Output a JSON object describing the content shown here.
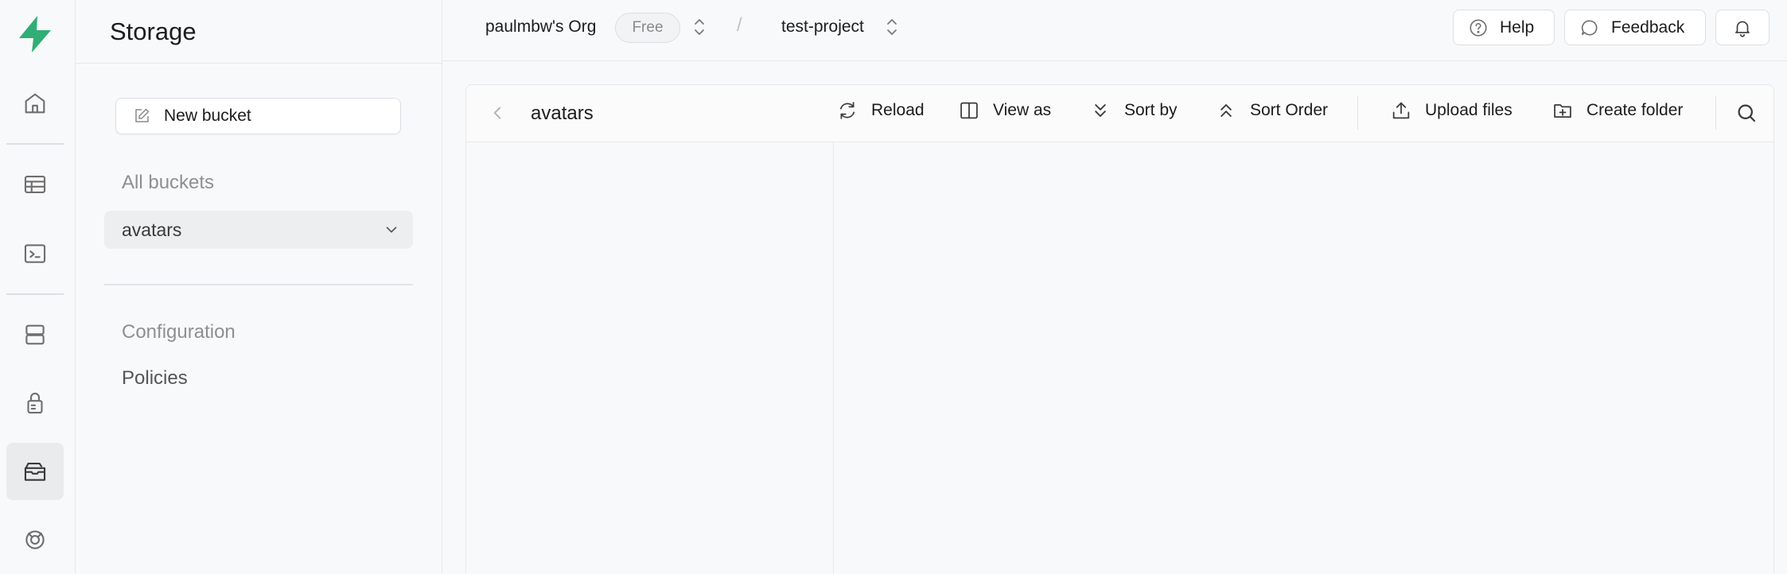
{
  "app": {
    "section_title": "Storage"
  },
  "rail": {
    "icons": [
      "logo-icon",
      "home-icon",
      "table-editor-icon",
      "sql-editor-icon",
      "database-icon",
      "auth-icon",
      "storage-icon",
      "realtime-icon"
    ],
    "active": "storage-icon",
    "brand_color": "#3ecf8e"
  },
  "sidebar": {
    "new_bucket_label": "New bucket",
    "all_buckets_label": "All buckets",
    "buckets": [
      {
        "label": "avatars",
        "selected": true
      }
    ],
    "configuration_label": "Configuration",
    "policies_label": "Policies"
  },
  "topbar": {
    "org_name": "paulmbw's Org",
    "plan_badge": "Free",
    "separator": "/",
    "project_name": "test-project",
    "help_label": "Help",
    "feedback_label": "Feedback"
  },
  "explorer": {
    "current_bucket": "avatars",
    "toolbar": {
      "reload_label": "Reload",
      "view_as_label": "View as",
      "sort_by_label": "Sort by",
      "sort_order_label": "Sort Order",
      "upload_label": "Upload files",
      "create_folder_label": "Create folder"
    }
  }
}
